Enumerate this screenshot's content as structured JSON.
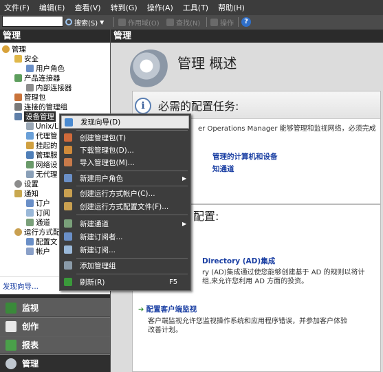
{
  "menubar": {
    "items": [
      "文件(F)",
      "编辑(E)",
      "查看(V)",
      "转到(G)",
      "操作(A)",
      "工具(T)",
      "帮助(H)"
    ]
  },
  "toolbar": {
    "search_label": "搜索(S)",
    "scope_label": "作用域(O)",
    "find_label": "查找(N)",
    "actions_label": "操作"
  },
  "left_panel": {
    "title": "管理",
    "tree": [
      {
        "label": "管理",
        "icon": "gear-icon"
      },
      {
        "label": "安全",
        "icon": "lock-icon"
      },
      {
        "label": "用户角色",
        "icon": "user-role-icon"
      },
      {
        "label": "产品连接器",
        "icon": "connector-icon"
      },
      {
        "label": "内部连接器",
        "icon": "connector-icon"
      },
      {
        "label": "管理包",
        "icon": "package-icon"
      },
      {
        "label": "连接的管理组",
        "icon": "group-icon"
      },
      {
        "label": "设备管理",
        "icon": "device-icon"
      },
      {
        "label": "Unix/Lin",
        "icon": "server-icon"
      },
      {
        "label": "代理管",
        "icon": "agent-icon"
      },
      {
        "label": "挂起的",
        "icon": "pending-icon"
      },
      {
        "label": "管理服",
        "icon": "server-icon"
      },
      {
        "label": "网络设",
        "icon": "network-icon"
      },
      {
        "label": "无代理",
        "icon": "agentless-icon"
      },
      {
        "label": "设置",
        "icon": "settings-icon"
      },
      {
        "label": "通知",
        "icon": "notification-icon"
      },
      {
        "label": "订户",
        "icon": "subscriber-icon"
      },
      {
        "label": "订阅",
        "icon": "subscription-icon"
      },
      {
        "label": "通道",
        "icon": "channel-icon"
      },
      {
        "label": "运行方式配",
        "icon": "runas-icon"
      },
      {
        "label": "配置文",
        "icon": "profile-icon"
      },
      {
        "label": "帐户",
        "icon": "account-icon"
      }
    ],
    "wizard_link": "发现向导...",
    "nav": [
      {
        "label": "监视",
        "icon": "monitor-icon"
      },
      {
        "label": "创作",
        "icon": "authoring-icon"
      },
      {
        "label": "报表",
        "icon": "report-icon"
      },
      {
        "label": "管理",
        "icon": "admin-icon"
      }
    ]
  },
  "right_panel": {
    "title": "管理",
    "overview_title": "管理 概述",
    "card1": {
      "title": "必需的配置任务:",
      "text": "er Operations Manager 能够管理和监视网络，必须完成",
      "link1": "管理的计算机和设备",
      "link2": "知通道"
    },
    "card2": {
      "title_fragment": "配置:",
      "link1": "Directory (AD)集成",
      "text1a": "ry (AD)集成通过使您能够创建基于 AD 的规则以将计",
      "text1b": "组,来允许您利用 AD 方面的投资。",
      "link2": "配置客户端监视",
      "text2a": "客户端监视允许您监视操作系统和应用程序错误，并参加客户体验",
      "text2b": "改善计划。"
    }
  },
  "context_menu": {
    "items": [
      {
        "label": "发现向导(D)",
        "icon": "discovery-icon",
        "highlighted": true
      },
      {
        "label": "创建管理包(T)",
        "icon": "create-pack-icon"
      },
      {
        "label": "下载管理包(D)...",
        "icon": "download-pack-icon"
      },
      {
        "label": "导入管理包(M)...",
        "icon": "import-pack-icon"
      },
      {
        "label": "新建用户角色",
        "icon": "user-role-icon",
        "submenu": true
      },
      {
        "label": "创建运行方式帐户(C)...",
        "icon": "runas-account-icon"
      },
      {
        "label": "创建运行方式配置文件(F)...",
        "icon": "runas-profile-icon"
      },
      {
        "label": "新建通道",
        "icon": "channel-icon",
        "submenu": true
      },
      {
        "label": "新建订阅者...",
        "icon": "subscriber-icon"
      },
      {
        "label": "新建订阅...",
        "icon": "subscription-icon"
      },
      {
        "label": "添加管理组",
        "icon": "add-group-icon"
      },
      {
        "label": "刷新(R)",
        "icon": "refresh-icon",
        "shortcut": "F5"
      }
    ]
  },
  "colors": {
    "dark_chrome": "#2b2b2b",
    "menu_bg": "#3d3d3d",
    "link_blue": "#1a3fa3",
    "highlight": "#e8e8e8"
  }
}
